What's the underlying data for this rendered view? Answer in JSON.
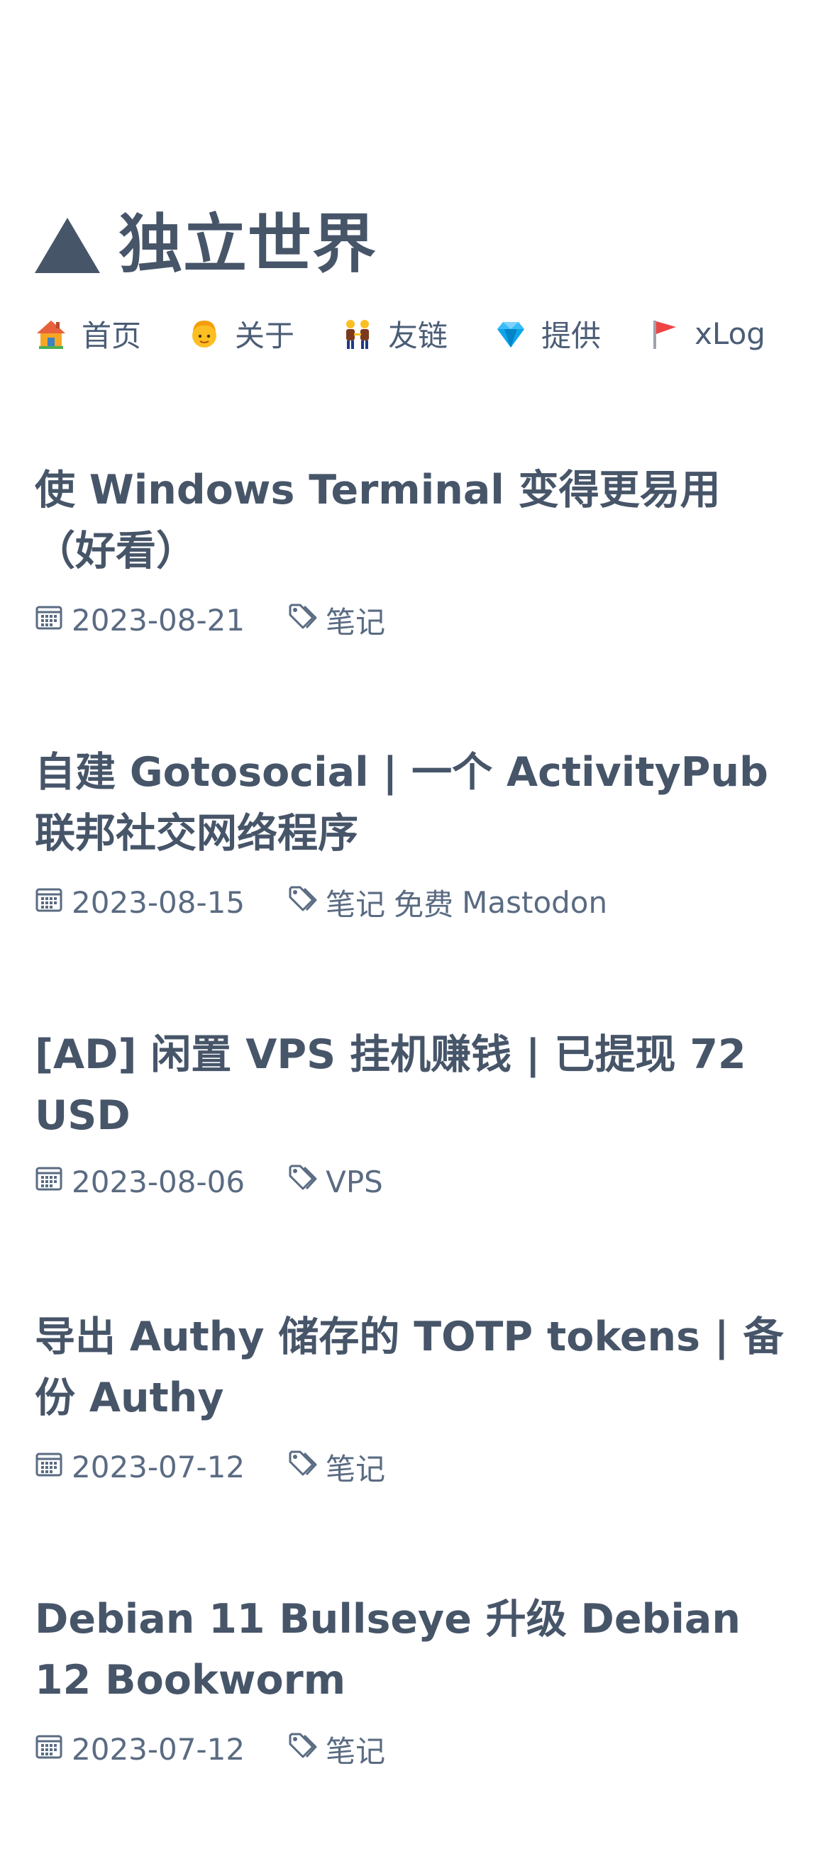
{
  "site": {
    "title": "独立世界"
  },
  "nav": {
    "items": [
      {
        "label": "首页",
        "icon": "house-icon"
      },
      {
        "label": "关于",
        "icon": "person-icon"
      },
      {
        "label": "友链",
        "icon": "people-holding-hands-icon"
      },
      {
        "label": "提供",
        "icon": "gem-icon"
      },
      {
        "label": "xLog",
        "icon": "flag-icon"
      }
    ]
  },
  "posts": [
    {
      "title": "使 Windows Terminal 变得更易用（好看）",
      "date": "2023-08-21",
      "tags": [
        "笔记"
      ]
    },
    {
      "title": "自建 Gotosocial | 一个 ActivityPub 联邦社交网络程序",
      "date": "2023-08-15",
      "tags": [
        "笔记",
        "免费",
        "Mastodon"
      ]
    },
    {
      "title": "[AD] 闲置 VPS 挂机赚钱 | 已提现 72 USD",
      "date": "2023-08-06",
      "tags": [
        "VPS"
      ]
    },
    {
      "title": "导出 Authy 储存的 TOTP tokens | 备份 Authy",
      "date": "2023-07-12",
      "tags": [
        "笔记"
      ]
    },
    {
      "title": "Debian 11 Bullseye 升级 Debian 12 Bookworm",
      "date": "2023-07-12",
      "tags": [
        "笔记"
      ]
    }
  ],
  "colors": {
    "text": "#475569",
    "meta": "#5a6b82",
    "background": "#ffffff"
  }
}
